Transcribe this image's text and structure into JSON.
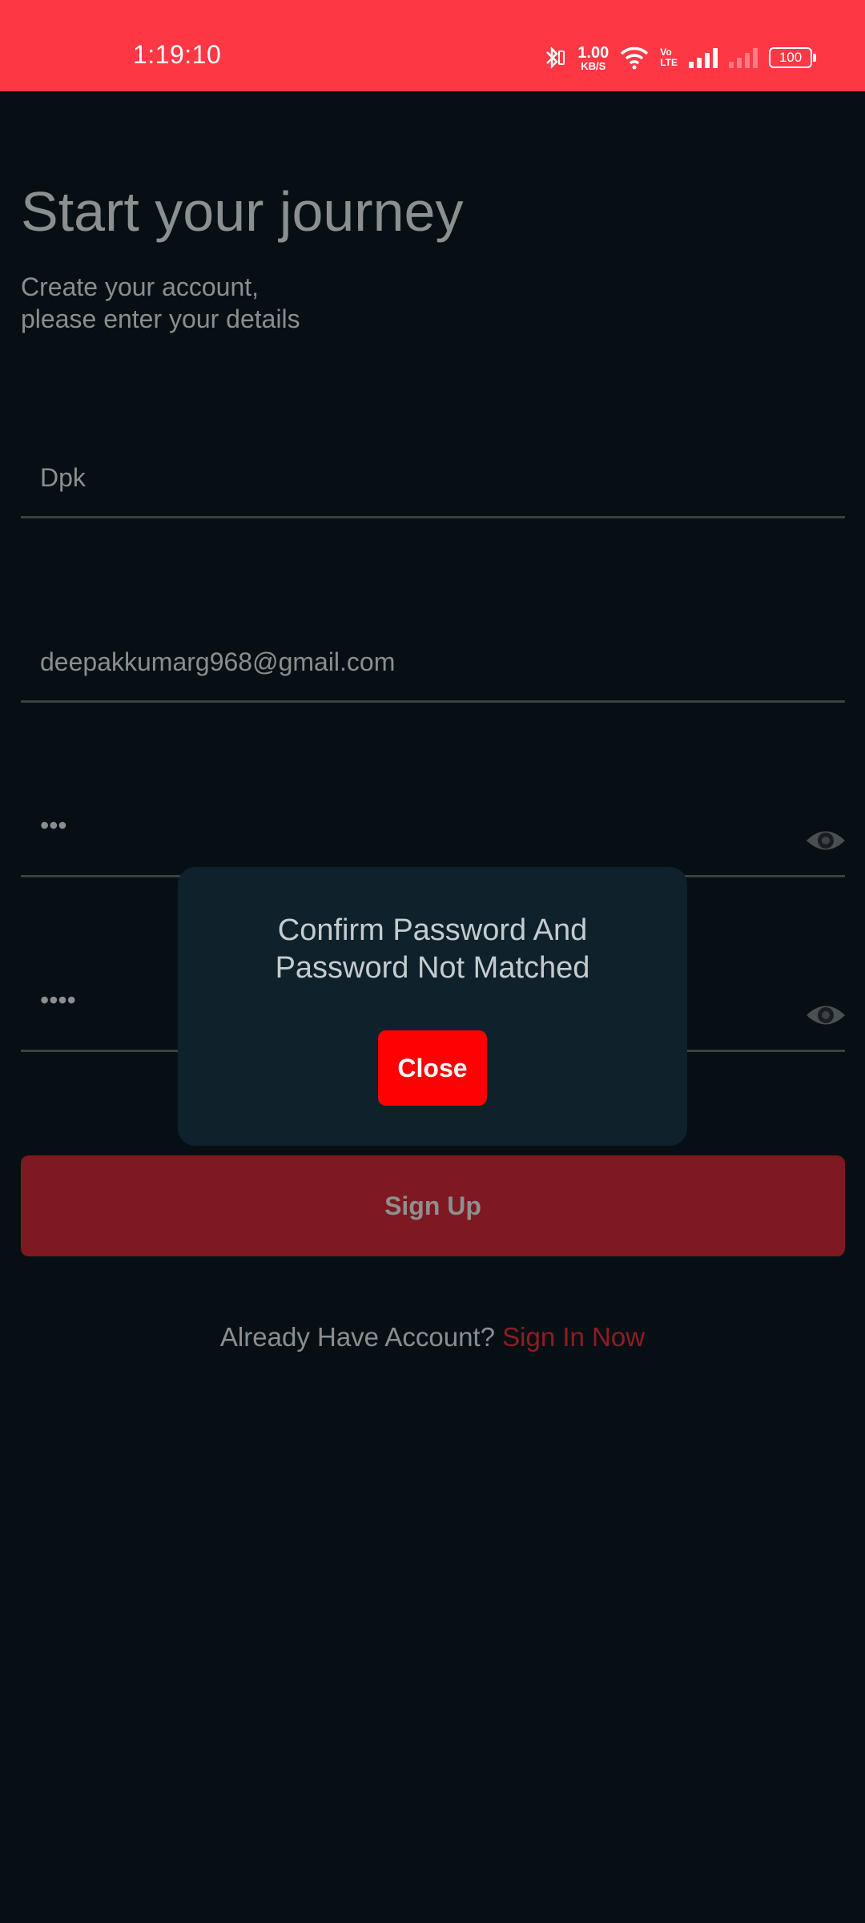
{
  "status_bar": {
    "time": "1:19:10",
    "net_speed_value": "1.00",
    "net_speed_unit": "KB/S",
    "volte_top": "Vo",
    "volte_bottom": "LTE",
    "battery": "100",
    "icons": [
      "bluetooth-icon",
      "wifi-icon",
      "signal-icon",
      "signal-no-sim-icon",
      "battery-icon"
    ]
  },
  "header": {
    "title": "Start your journey",
    "subtitle_line1": "Create your account,",
    "subtitle_line2": "please enter your details"
  },
  "form": {
    "name_value": "Dpk",
    "email_value": "deepakkumarg968@gmail.com",
    "password_value": "•••",
    "confirm_password_value": "••••",
    "signup_label": "Sign Up"
  },
  "footer": {
    "prompt": "Already Have Account?",
    "link": "Sign In Now"
  },
  "dialog": {
    "message_line1": "Confirm Password And",
    "message_line2": "Password Not Matched",
    "close_label": "Close"
  },
  "colors": {
    "status_bar": "#fd3844",
    "background": "#061014",
    "dialog_bg": "#0f212b",
    "close_button": "#fe0103",
    "signup_button": "#7e1921",
    "link": "#8f1c24"
  }
}
